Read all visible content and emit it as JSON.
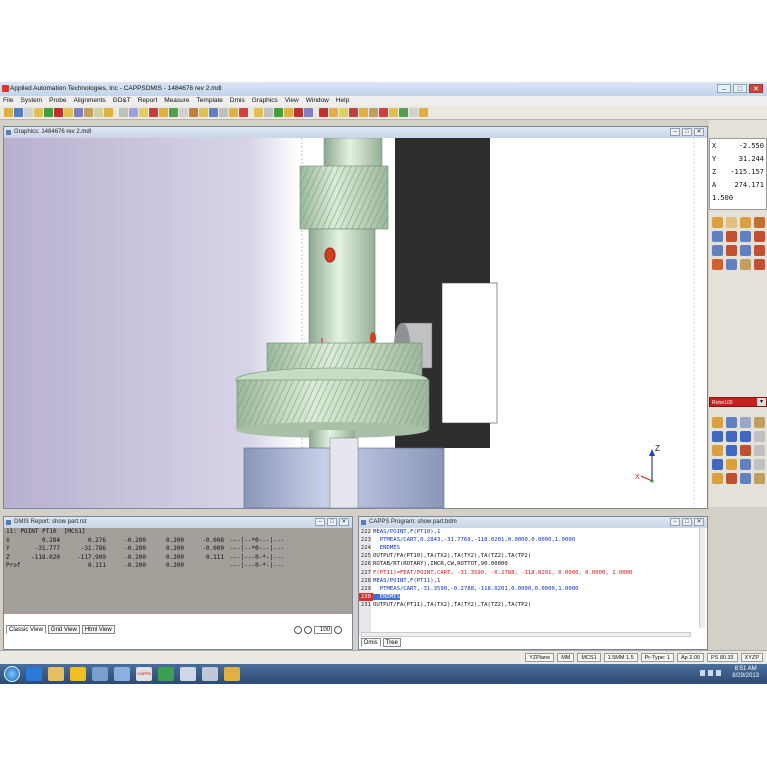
{
  "window": {
    "title": "Applied Automation Technologies, Inc - CAPPSDMIS - 1484676 rev 2.mdl",
    "min": "–",
    "max": "□",
    "close": "✕"
  },
  "menu": [
    "File",
    "System",
    "Probe",
    "Alignments",
    "GD&T",
    "Report",
    "Measure",
    "Template",
    "Dmis",
    "Graphics",
    "View",
    "Window",
    "Help"
  ],
  "graphics": {
    "title": "Graphics: 1484676 rev 2.mdl",
    "axis_z": "Z",
    "axis_x": "X"
  },
  "readout": [
    {
      "axis": "X",
      "value": "-2.550"
    },
    {
      "axis": "Y",
      "value": "31.244"
    },
    {
      "axis": "Z",
      "value": "-115.157"
    },
    {
      "axis": "A",
      "value": "274.171"
    },
    {
      "axis": "1.500",
      "value": ""
    }
  ],
  "probe_select": {
    "value": "Rotor100",
    "arrow": "▾"
  },
  "report": {
    "title": "DMIS Report: show part.rst",
    "header": "11: POINT PT10  [MCS1]",
    "rows": [
      {
        "c0": "X",
        "c1": ":",
        "v1": "0.284",
        "v2": "0.276",
        "v3": "-0.200",
        "v4": "0.200",
        "v5": "-0.008",
        "bar": "---|--*0---|---"
      },
      {
        "c0": "Y",
        "c1": ":",
        "v1": "-31.777",
        "v2": "-31.786",
        "v3": "-0.200",
        "v4": "0.200",
        "v5": "-0.009",
        "bar": "---|--*0---|---"
      },
      {
        "c0": "Z",
        "c1": ":",
        "v1": "-118.020",
        "v2": "-117.909",
        "v3": "-0.200",
        "v4": "0.200",
        "v5": "0.111",
        "bar": "---|---0-*-|---"
      },
      {
        "c0": "Prof",
        "c1": ":",
        "v1": "",
        "v2": "0.111",
        "v3": "-0.200",
        "v4": "0.200",
        "v5": "",
        "bar": "---|---0-*-|---"
      }
    ],
    "tabs": [
      "Classic View",
      "Grid View",
      "Html View"
    ],
    "zoom": "100"
  },
  "program": {
    "title": "CAPPS Program: show part.bdm",
    "lines": [
      {
        "n": "222",
        "t": "MEAS/POINT,F(PT10),1",
        "c": "blue"
      },
      {
        "n": "223",
        "t": "  PTMEAS/CART,0.2843,-31.7769,-118.0201,0.0000,0.0000,1.0000",
        "c": "blue"
      },
      {
        "n": "224",
        "t": "  ENDMES",
        "c": "blue"
      },
      {
        "n": "225",
        "t": "OUTPUT/FA(PT10),TA(TX2),TA(TY2),TA(TZ2),TA(TP2)",
        "c": "black"
      },
      {
        "n": "226",
        "t": "ROTAB/RT(ROTARY),INCR,CW,ROTTOT,90.00000",
        "c": "black"
      },
      {
        "n": "227",
        "t": "F(PT11)=FEAT/POINT,CART, -31.3590, -0.2788, -118.0201, 0.0000, 0.0000, 1.0000",
        "c": "red"
      },
      {
        "n": "228",
        "t": "MEAS/POINT,F(PT11),1",
        "c": "blue"
      },
      {
        "n": "229",
        "t": "  PTMEAS/CART,-31.3590,-0.2788,-118.0201,0.0000,0.0000,1.0000",
        "c": "blue"
      },
      {
        "n": "230",
        "t": "  ENDMES",
        "c": "sel"
      },
      {
        "n": "231",
        "t": "OUTPUT/FA(PT11),TA(TX2),TA(TY2),TA(TZ2),TA(TP2)",
        "c": "black"
      }
    ],
    "tabs": [
      "Dmis",
      "Tree"
    ]
  },
  "status": [
    "YZPlane",
    "MM",
    "MCS1",
    "1.5MM 1.5",
    "Pr-Type: 1",
    "Ap 2.00",
    "PS 80.33",
    "XYZP"
  ],
  "clock": {
    "time": "8:51 AM",
    "date": "8/29/2013"
  },
  "taskbar_app": "CAPPS DMIS"
}
